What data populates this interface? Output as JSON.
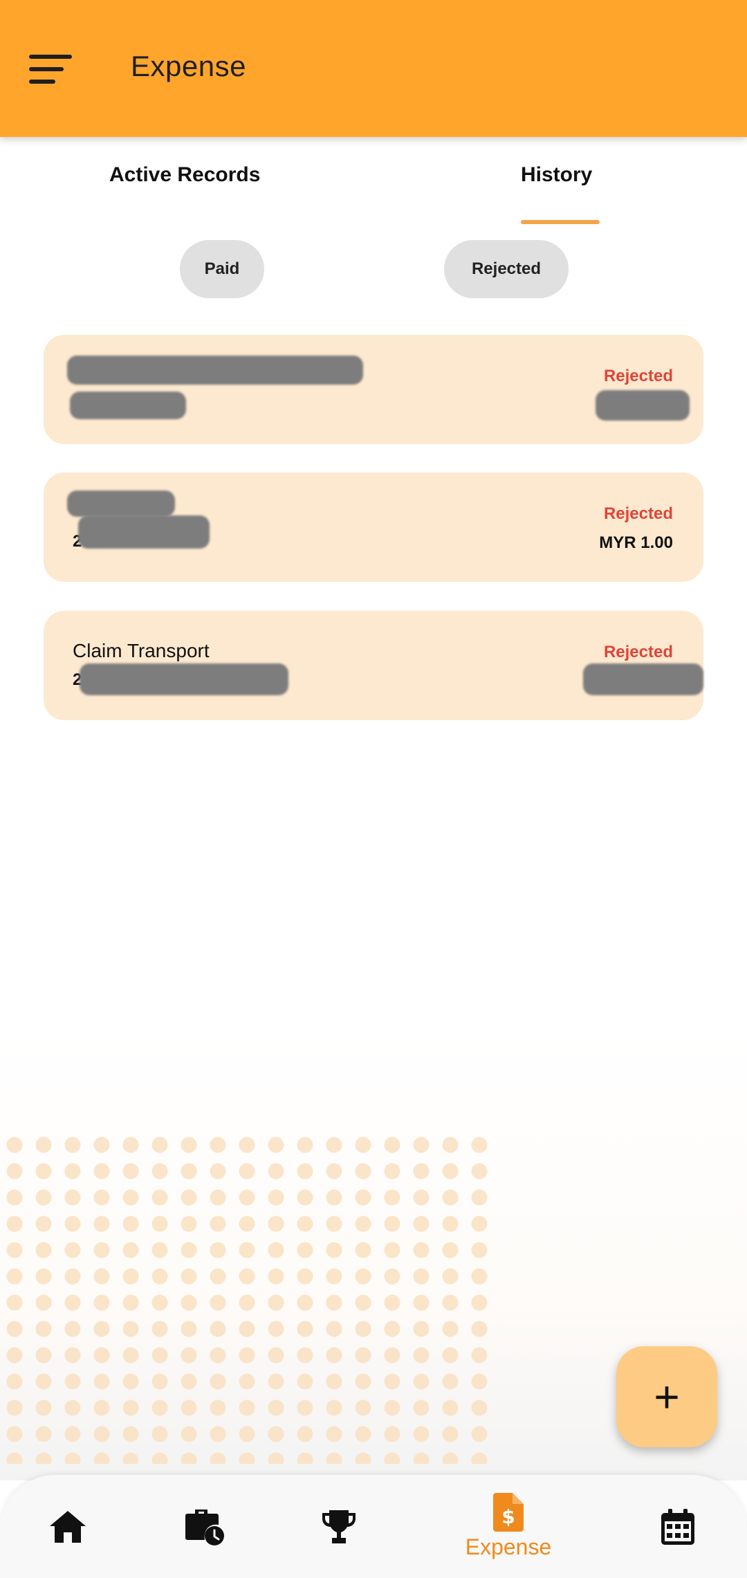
{
  "app_bar": {
    "title": "Expense",
    "menu_icon": "menu-icon",
    "color": "#ffa52b"
  },
  "tabs": [
    {
      "label": "Active Records",
      "active": false
    },
    {
      "label": "History",
      "active": true
    }
  ],
  "filters": [
    {
      "label": "Paid"
    },
    {
      "label": "Rejected"
    }
  ],
  "records": [
    {
      "title": "",
      "date": "",
      "status": "Rejected",
      "amount": ""
    },
    {
      "title": "",
      "date": "202",
      "status": "Rejected",
      "amount": "MYR 1.00"
    },
    {
      "title": "Claim Transport",
      "date": "2",
      "status": "Rejected",
      "amount": ""
    }
  ],
  "fab": {
    "icon": "plus-icon",
    "symbol": "+"
  },
  "bottom_nav": [
    {
      "icon": "home-icon",
      "label": ""
    },
    {
      "icon": "briefcase-clock-icon",
      "label": ""
    },
    {
      "icon": "trophy-icon",
      "label": ""
    },
    {
      "icon": "expense-document-icon",
      "label": "Expense",
      "active": true
    },
    {
      "icon": "calendar-icon",
      "label": ""
    }
  ],
  "colors": {
    "accent": "#ffa52b",
    "card": "#fde9cf",
    "rejected": "#e0443a",
    "active_nav": "#f08a1c"
  }
}
